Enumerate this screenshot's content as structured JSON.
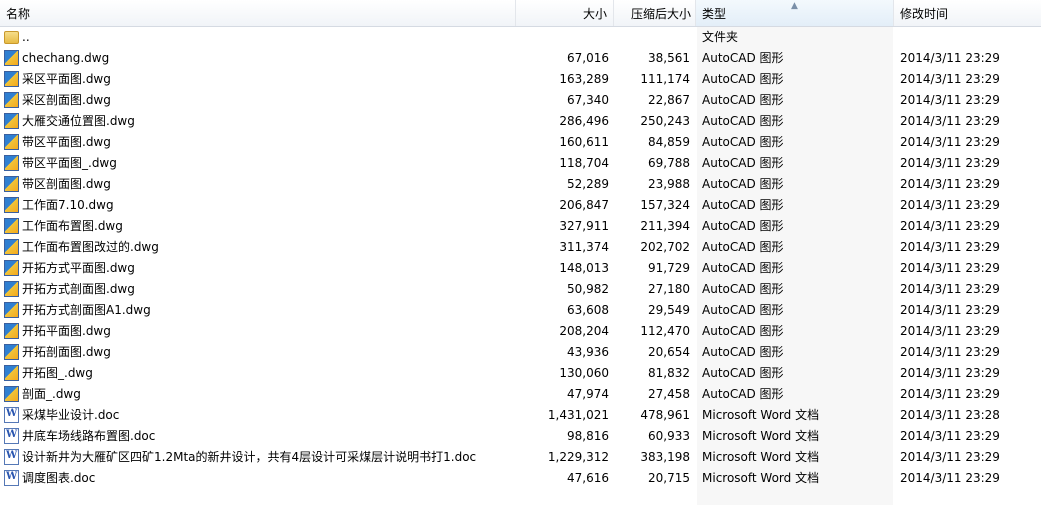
{
  "columns": {
    "name": "名称",
    "size": "大小",
    "compressed": "压缩后大小",
    "type": "类型",
    "modified": "修改时间"
  },
  "rows": [
    {
      "name": "..",
      "size": "",
      "compressed": "",
      "type": "文件夹",
      "modified": "",
      "icon": "folder-icon"
    },
    {
      "name": "chechang.dwg",
      "size": "67,016",
      "compressed": "38,561",
      "type": "AutoCAD 图形",
      "modified": "2014/3/11 23:29",
      "icon": "dwg-file-icon"
    },
    {
      "name": "采区平面图.dwg",
      "size": "163,289",
      "compressed": "111,174",
      "type": "AutoCAD 图形",
      "modified": "2014/3/11 23:29",
      "icon": "dwg-file-icon"
    },
    {
      "name": "采区剖面图.dwg",
      "size": "67,340",
      "compressed": "22,867",
      "type": "AutoCAD 图形",
      "modified": "2014/3/11 23:29",
      "icon": "dwg-file-icon"
    },
    {
      "name": "大雁交通位置图.dwg",
      "size": "286,496",
      "compressed": "250,243",
      "type": "AutoCAD 图形",
      "modified": "2014/3/11 23:29",
      "icon": "dwg-file-icon"
    },
    {
      "name": "带区平面图.dwg",
      "size": "160,611",
      "compressed": "84,859",
      "type": "AutoCAD 图形",
      "modified": "2014/3/11 23:29",
      "icon": "dwg-file-icon"
    },
    {
      "name": "带区平面图_.dwg",
      "size": "118,704",
      "compressed": "69,788",
      "type": "AutoCAD 图形",
      "modified": "2014/3/11 23:29",
      "icon": "dwg-file-icon"
    },
    {
      "name": "带区剖面图.dwg",
      "size": "52,289",
      "compressed": "23,988",
      "type": "AutoCAD 图形",
      "modified": "2014/3/11 23:29",
      "icon": "dwg-file-icon"
    },
    {
      "name": "工作面7.10.dwg",
      "size": "206,847",
      "compressed": "157,324",
      "type": "AutoCAD 图形",
      "modified": "2014/3/11 23:29",
      "icon": "dwg-file-icon"
    },
    {
      "name": "工作面布置图.dwg",
      "size": "327,911",
      "compressed": "211,394",
      "type": "AutoCAD 图形",
      "modified": "2014/3/11 23:29",
      "icon": "dwg-file-icon"
    },
    {
      "name": "工作面布置图改过的.dwg",
      "size": "311,374",
      "compressed": "202,702",
      "type": "AutoCAD 图形",
      "modified": "2014/3/11 23:29",
      "icon": "dwg-file-icon"
    },
    {
      "name": "开拓方式平面图.dwg",
      "size": "148,013",
      "compressed": "91,729",
      "type": "AutoCAD 图形",
      "modified": "2014/3/11 23:29",
      "icon": "dwg-file-icon"
    },
    {
      "name": "开拓方式剖面图.dwg",
      "size": "50,982",
      "compressed": "27,180",
      "type": "AutoCAD 图形",
      "modified": "2014/3/11 23:29",
      "icon": "dwg-file-icon"
    },
    {
      "name": "开拓方式剖面图A1.dwg",
      "size": "63,608",
      "compressed": "29,549",
      "type": "AutoCAD 图形",
      "modified": "2014/3/11 23:29",
      "icon": "dwg-file-icon"
    },
    {
      "name": "开拓平面图.dwg",
      "size": "208,204",
      "compressed": "112,470",
      "type": "AutoCAD 图形",
      "modified": "2014/3/11 23:29",
      "icon": "dwg-file-icon"
    },
    {
      "name": "开拓剖面图.dwg",
      "size": "43,936",
      "compressed": "20,654",
      "type": "AutoCAD 图形",
      "modified": "2014/3/11 23:29",
      "icon": "dwg-file-icon"
    },
    {
      "name": "开拓图_.dwg",
      "size": "130,060",
      "compressed": "81,832",
      "type": "AutoCAD 图形",
      "modified": "2014/3/11 23:29",
      "icon": "dwg-file-icon"
    },
    {
      "name": "剖面_.dwg",
      "size": "47,974",
      "compressed": "27,458",
      "type": "AutoCAD 图形",
      "modified": "2014/3/11 23:29",
      "icon": "dwg-file-icon"
    },
    {
      "name": "采煤毕业设计.doc",
      "size": "1,431,021",
      "compressed": "478,961",
      "type": "Microsoft Word 文档",
      "modified": "2014/3/11 23:28",
      "icon": "word-doc-icon"
    },
    {
      "name": "井底车场线路布置图.doc",
      "size": "98,816",
      "compressed": "60,933",
      "type": "Microsoft Word 文档",
      "modified": "2014/3/11 23:29",
      "icon": "word-doc-icon"
    },
    {
      "name": "设计新井为大雁矿区四矿1.2Mta的新井设计，共有4层设计可采煤层计说明书打1.doc",
      "size": "1,229,312",
      "compressed": "383,198",
      "type": "Microsoft Word 文档",
      "modified": "2014/3/11 23:29",
      "icon": "word-doc-icon"
    },
    {
      "name": "调度图表.doc",
      "size": "47,616",
      "compressed": "20,715",
      "type": "Microsoft Word 文档",
      "modified": "2014/3/11 23:29",
      "icon": "word-doc-icon"
    }
  ]
}
